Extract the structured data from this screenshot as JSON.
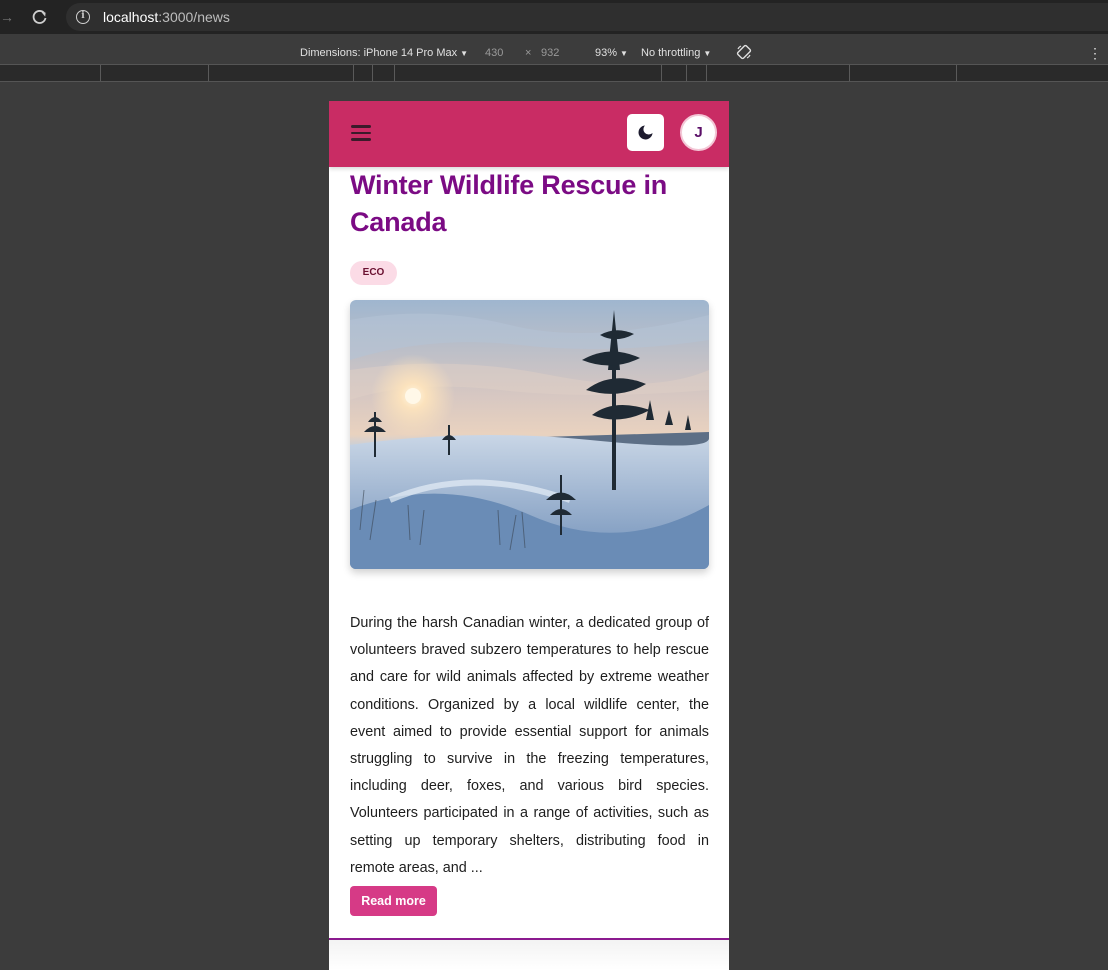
{
  "browser": {
    "url_host": "localhost",
    "url_path": ":3000/news"
  },
  "devtools": {
    "dimensions_label": "Dimensions: iPhone 14 Pro Max",
    "width": "430",
    "times": "×",
    "height": "932",
    "zoom": "93%",
    "throttling": "No throttling"
  },
  "header": {
    "avatar_initial": "J"
  },
  "article": {
    "title": "Winter Wildlife Rescue in Canada",
    "tag": "ECO",
    "body": "During the harsh Canadian winter, a dedicated group of volunteers braved subzero temperatures to help rescue and care for wild animals affected by extreme weather conditions. Organized by a local wildlife center, the event aimed to provide essential support for animals struggling to survive in the freezing temperatures, including deer, foxes, and various bird species. Volunteers participated in a range of activities, such as setting up temporary shelters, distributing food in remote areas, and ...",
    "read_more": "Read more"
  },
  "colors": {
    "topbar": "#c92c64",
    "title": "#7b0b84",
    "tag_bg": "#fbdbe6",
    "button": "#d63a86"
  }
}
